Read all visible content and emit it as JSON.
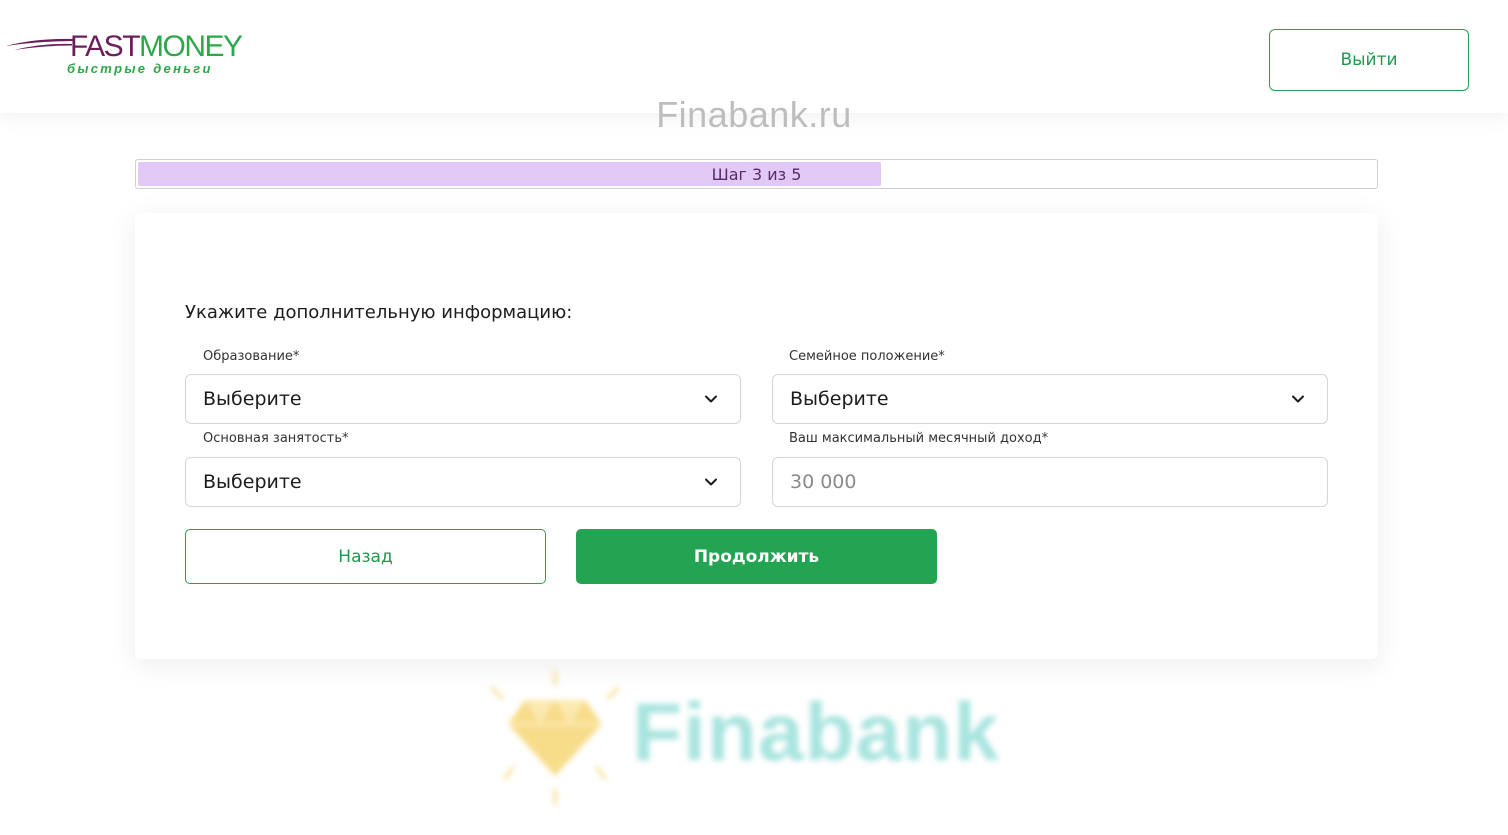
{
  "header": {
    "logo": {
      "word_part1": "FAST",
      "word_part2": "MONEY",
      "tagline": "быстрые деньги"
    },
    "logout_label": "Выйти"
  },
  "watermark": {
    "text": "Finabank.ru",
    "logo_word": "Finabank"
  },
  "progress": {
    "label": "Шаг 3 из 5",
    "fraction": 0.6,
    "fill_color": "#e1c8f5"
  },
  "form": {
    "title": "Укажите дополнительную информацию:",
    "fields": [
      {
        "label": "Образование*",
        "value": "Выберите",
        "type": "select"
      },
      {
        "label": "Семейное положение*",
        "value": "Выберите",
        "type": "select"
      },
      {
        "label": "Основная занятость*",
        "value": "Выберите",
        "type": "select"
      },
      {
        "label": "Ваш максимальный месячный доход*",
        "value": "",
        "placeholder": "30 000",
        "type": "input"
      }
    ],
    "back_label": "Назад",
    "continue_label": "Продолжить"
  },
  "colors": {
    "accent": "#22a453",
    "brand_purple": "#6b1f5a"
  },
  "icons": {
    "select_arrow": "chevron-down-icon"
  }
}
